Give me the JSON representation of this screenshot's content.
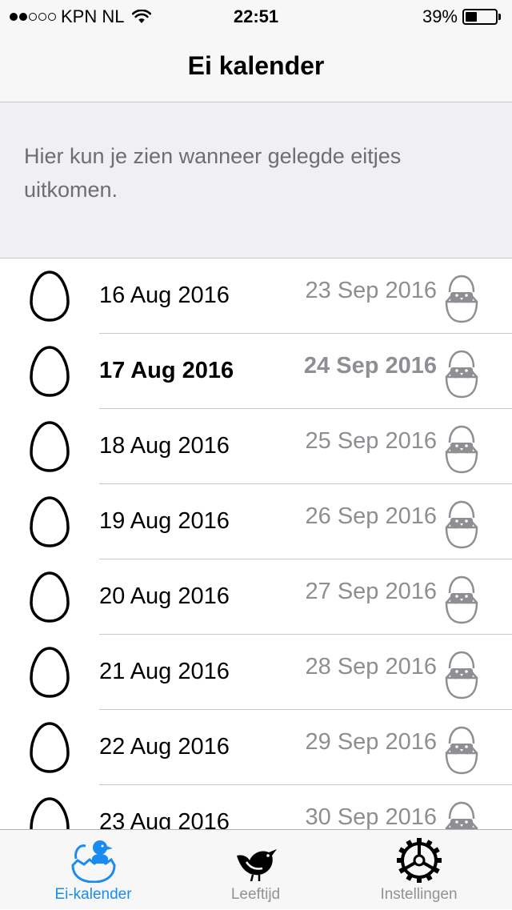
{
  "status_bar": {
    "signal_dots": [
      true,
      true,
      false,
      false,
      false
    ],
    "carrier": "KPN NL",
    "time": "22:51",
    "battery_percent": "39%",
    "battery_level": 0.39
  },
  "nav": {
    "title": "Ei kalender"
  },
  "info": {
    "text": "Hier kun je zien wanneer gelegde eitjes uitkomen."
  },
  "rows": [
    {
      "laid": "16 Aug 2016",
      "hatch": "23 Sep 2016",
      "bold": false
    },
    {
      "laid": "17 Aug 2016",
      "hatch": "24 Sep 2016",
      "bold": true
    },
    {
      "laid": "18 Aug 2016",
      "hatch": "25 Sep 2016",
      "bold": false
    },
    {
      "laid": "19 Aug 2016",
      "hatch": "26 Sep 2016",
      "bold": false
    },
    {
      "laid": "20 Aug 2016",
      "hatch": "27 Sep 2016",
      "bold": false
    },
    {
      "laid": "21 Aug 2016",
      "hatch": "28 Sep 2016",
      "bold": false
    },
    {
      "laid": "22 Aug 2016",
      "hatch": "29 Sep 2016",
      "bold": false
    },
    {
      "laid": "23 Aug 2016",
      "hatch": "30 Sep 2016",
      "bold": false
    }
  ],
  "tabs": [
    {
      "label": "Ei-kalender",
      "icon": "hatching-chick-icon",
      "active": true
    },
    {
      "label": "Leeftijd",
      "icon": "bird-icon",
      "active": false
    },
    {
      "label": "Instellingen",
      "icon": "gear-icon",
      "active": false
    }
  ],
  "colors": {
    "accent": "#1a8cf0",
    "secondary_text": "#8e8e93",
    "header_bg": "#efeff4"
  }
}
